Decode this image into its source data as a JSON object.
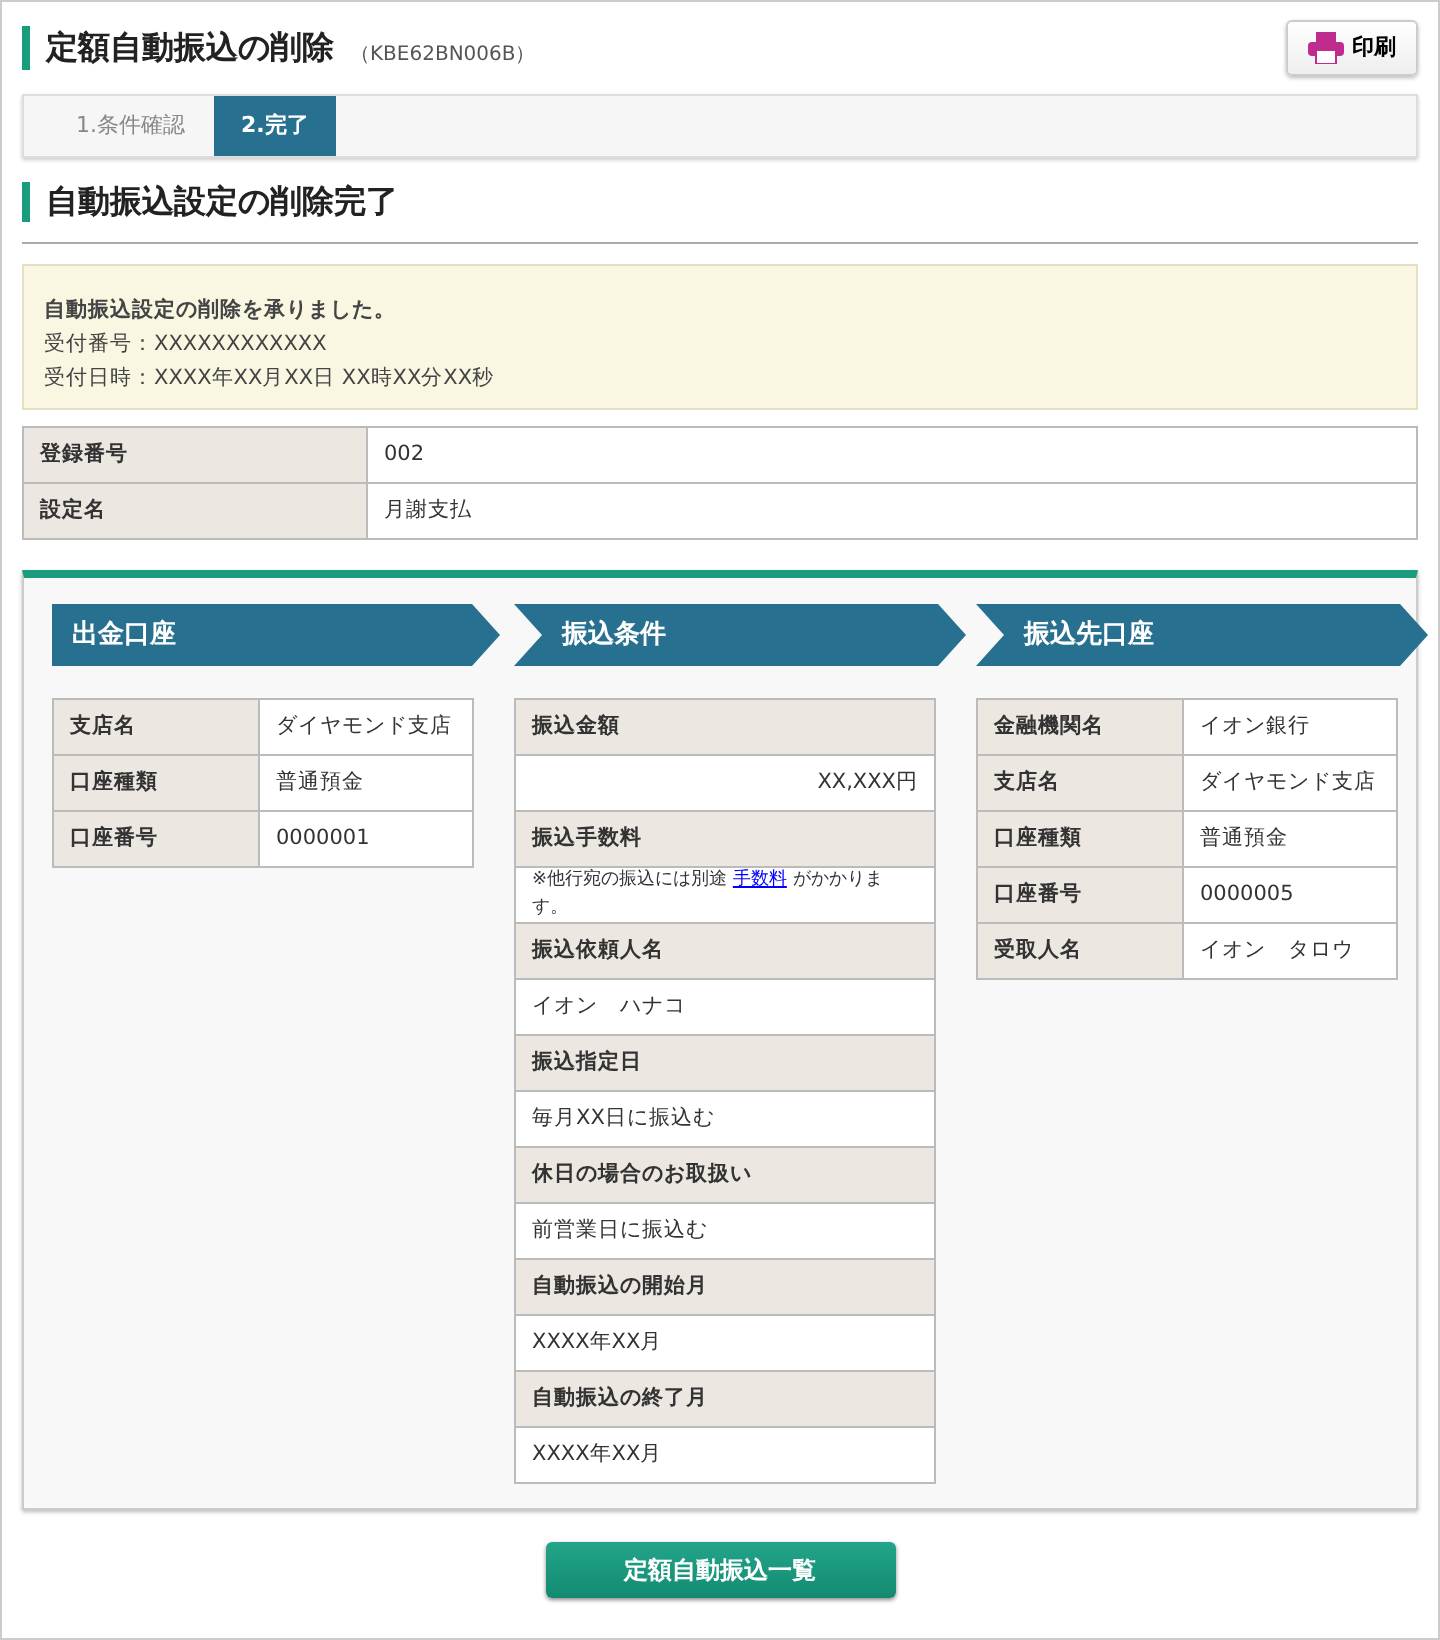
{
  "header": {
    "title": "定額自動振込の削除",
    "code": "（KBE62BN006B）",
    "print_button": "印刷"
  },
  "steps": [
    {
      "label": "1.条件確認",
      "selected": false
    },
    {
      "label": "2.完了",
      "selected": true
    }
  ],
  "section_title": "自動振込設定の削除完了",
  "notice": {
    "heading": "自動振込設定の削除を承りました。",
    "lines": [
      "受付番号：XXXXXXXXXXXX",
      "受付日時：XXXX年XX月XX日 XX時XX分XX秒"
    ]
  },
  "summary": [
    {
      "label": "登録番号",
      "value": "002"
    },
    {
      "label": "設定名",
      "value": "月謝支払"
    }
  ],
  "panels": [
    {
      "title": "出金口座",
      "kind": "side",
      "rows": [
        {
          "label": "支店名",
          "value": "ダイヤモンド支店"
        },
        {
          "label": "口座種類",
          "value": "普通預金"
        },
        {
          "label": "口座番号",
          "value": "0000001"
        }
      ]
    },
    {
      "title": "振込条件",
      "kind": "stacked",
      "rows": [
        {
          "label": "振込金額",
          "value": "XX,XXX円",
          "kind": "amount"
        },
        {
          "label": "振込手数料",
          "note": {
            "before": "※他行宛の振込には別途",
            "link": "手数料",
            "after": "がかかります。"
          }
        },
        {
          "label": "振込依頼人名",
          "value": "イオン　ハナコ"
        },
        {
          "label": "振込指定日",
          "value": "毎月XX日に振込む"
        },
        {
          "label": "休日の場合のお取扱い",
          "value": "前営業日に振込む"
        },
        {
          "label": "自動振込の開始月",
          "value": "XXXX年XX月"
        },
        {
          "label": "自動振込の終了月",
          "value": "XXXX年XX月"
        }
      ]
    },
    {
      "title": "振込先口座",
      "kind": "side",
      "rows": [
        {
          "label": "金融機関名",
          "value": "イオン銀行"
        },
        {
          "label": "支店名",
          "value": "ダイヤモンド支店"
        },
        {
          "label": "口座種類",
          "value": "普通預金"
        },
        {
          "label": "口座番号",
          "value": "0000005"
        },
        {
          "label": "受取人名",
          "value": "イオン　タロウ"
        }
      ]
    }
  ],
  "footer_button": "定額自動振込一覧"
}
